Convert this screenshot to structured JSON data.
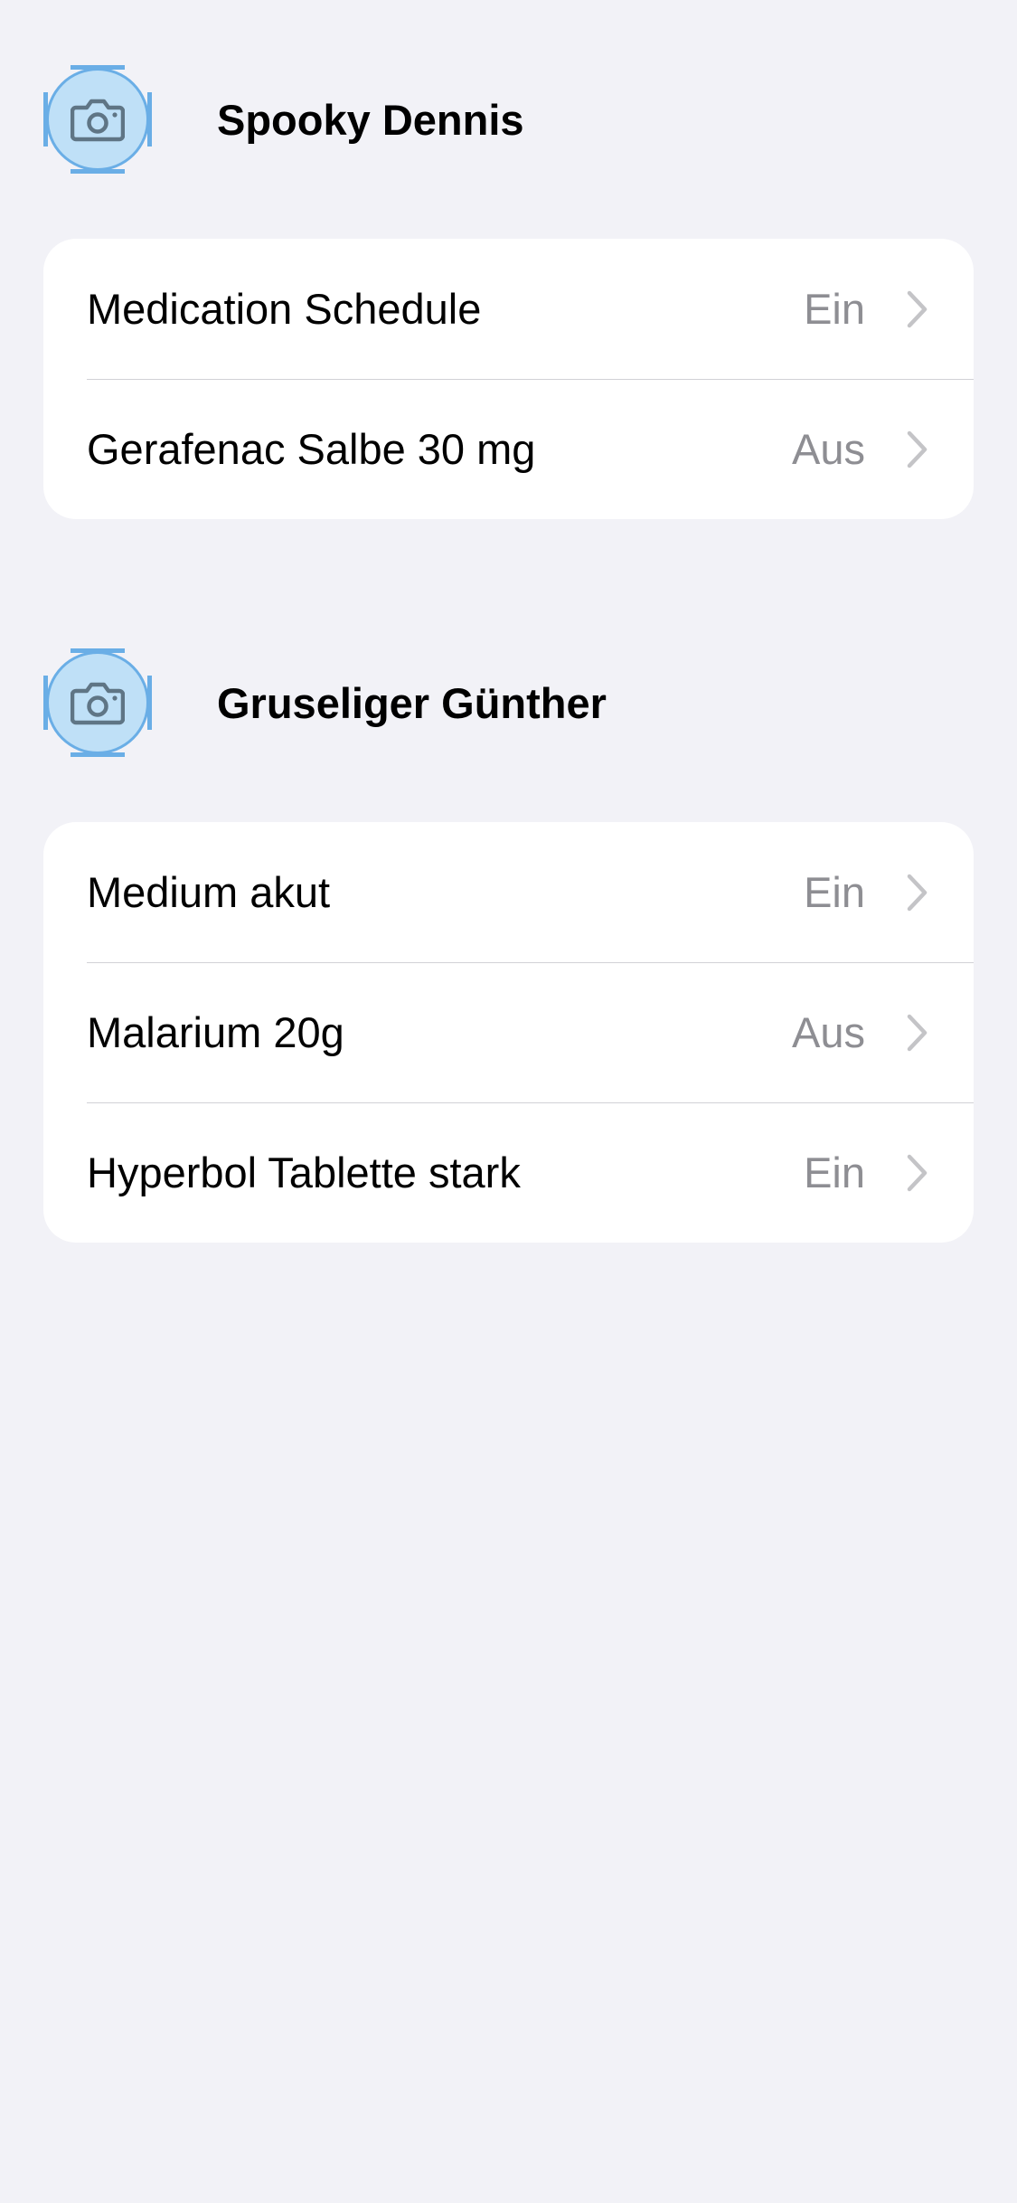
{
  "groups": [
    {
      "name": "Spooky Dennis",
      "avatar_icon": "camera-icon",
      "items": [
        {
          "label": "Medication Schedule",
          "value": "Ein"
        },
        {
          "label": "Gerafenac Salbe 30 mg",
          "value": "Aus"
        }
      ]
    },
    {
      "name": "Gruseliger Günther",
      "avatar_icon": "camera-icon",
      "items": [
        {
          "label": "Medium akut",
          "value": "Ein"
        },
        {
          "label": "Malarium 20g",
          "value": "Aus"
        },
        {
          "label": "Hyperbol Tablette stark",
          "value": "Ein"
        }
      ]
    }
  ],
  "colors": {
    "background": "#f2f2f7",
    "card": "#ffffff",
    "avatar_fill": "#bfe0f7",
    "avatar_border": "#6aaee6",
    "secondary_text": "#8e8e93",
    "chevron": "#c4c4c7"
  }
}
